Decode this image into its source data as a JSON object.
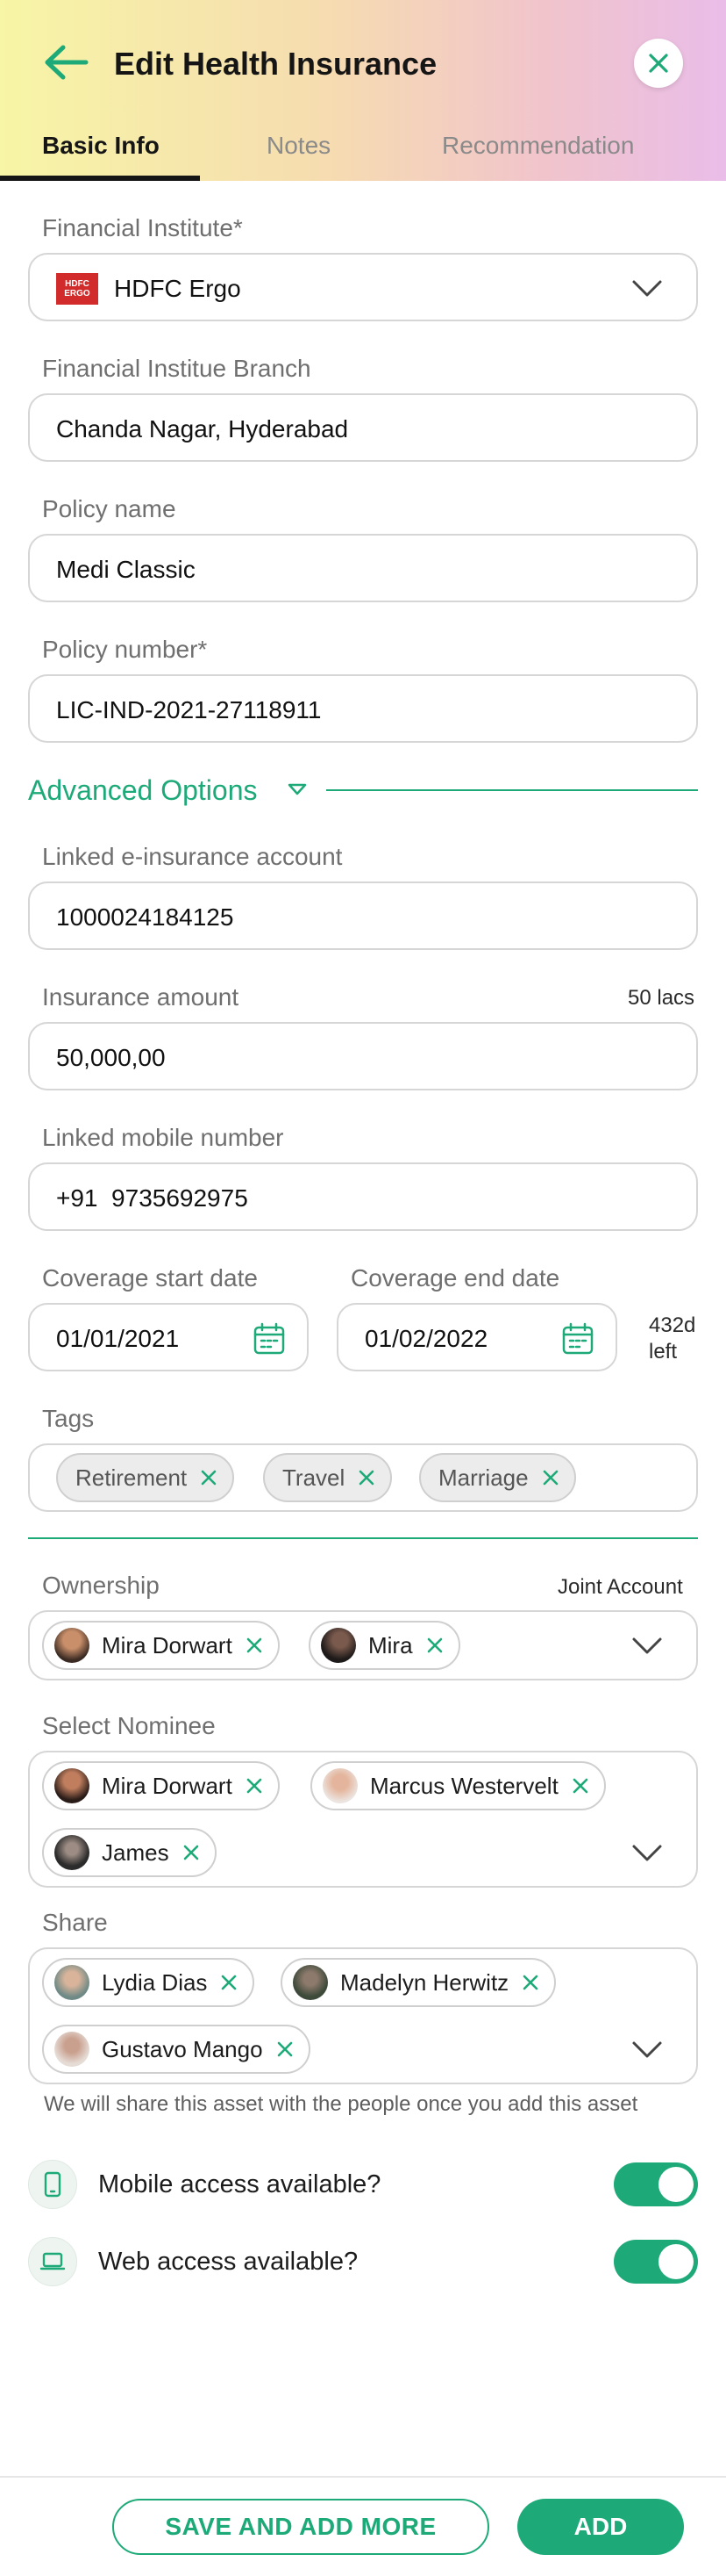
{
  "header": {
    "title": "Edit Health Insurance",
    "tabs": [
      {
        "label": "Basic Info",
        "active": true
      },
      {
        "label": "Notes",
        "active": false
      },
      {
        "label": "Recommendation",
        "active": false
      }
    ]
  },
  "colors": {
    "accent": "#1daa78",
    "brand_red": "#d22b2b"
  },
  "institute": {
    "label": "Financial Institute*",
    "value": "HDFC Ergo",
    "logo_text": [
      "HDFC",
      "ERGO"
    ]
  },
  "branch": {
    "label": "Financial Institue Branch",
    "value": "Chanda Nagar, Hyderabad"
  },
  "policy_name": {
    "label": "Policy name",
    "value": "Medi Classic"
  },
  "policy_number": {
    "label": "Policy number*",
    "value": "LIC-IND-2021-27118911"
  },
  "advanced": {
    "label": "Advanced Options"
  },
  "linked_account": {
    "label": "Linked e-insurance account",
    "value": "1000024184125"
  },
  "amount": {
    "label": "Insurance amount",
    "note": "50 lacs",
    "value": "50,000,00"
  },
  "mobile": {
    "label": "Linked mobile number",
    "value": "+91  9735692975"
  },
  "coverage": {
    "start_label": "Coverage start date",
    "start_value": "01/01/2021",
    "end_label": "Coverage end date",
    "end_value": "01/02/2022",
    "left_days": "432d",
    "left_word": "left"
  },
  "tags": {
    "label": "Tags",
    "items": [
      "Retirement",
      "Travel",
      "Marriage"
    ]
  },
  "ownership": {
    "label": "Ownership",
    "note": "Joint Account",
    "items": [
      "Mira Dorwart",
      "Mira"
    ]
  },
  "nominee": {
    "label": "Select Nominee",
    "items": [
      "Mira Dorwart",
      "Marcus Westervelt",
      "James"
    ]
  },
  "share": {
    "label": "Share",
    "items": [
      "Lydia Dias",
      "Madelyn Herwitz",
      "Gustavo Mango"
    ],
    "hint": "We will share this asset with the people once you add this asset"
  },
  "access": [
    {
      "label": "Mobile access available?",
      "enabled": true,
      "icon": "mobile-icon"
    },
    {
      "label": "Web access available?",
      "enabled": true,
      "icon": "laptop-icon"
    }
  ],
  "footer": {
    "save_more": "SAVE AND ADD MORE",
    "add": "ADD"
  }
}
